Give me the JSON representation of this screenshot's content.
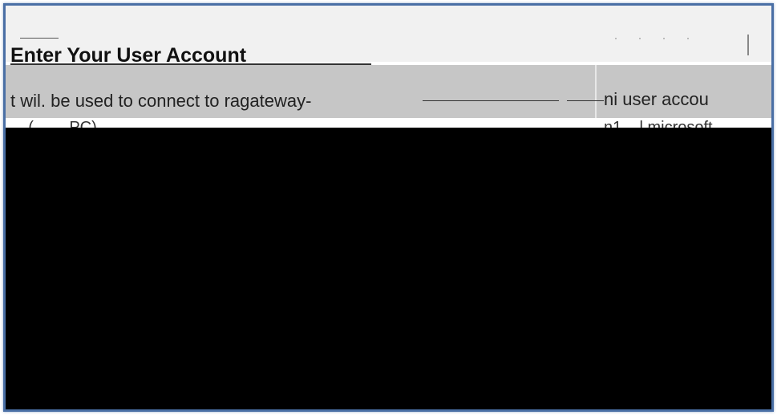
{
  "dialog": {
    "title": "Enter Your User Account",
    "line_left": "t wil. be used to connect to ragateway-",
    "line_right": "ni  user accou",
    "partial_left": "... (... ... PC) ... ... ... ...",
    "partial_right": "n1 ...l microsoft"
  },
  "colors": {
    "frame_border": "#4a6fa5",
    "top_background": "#f1f1f1",
    "panel_grey": "#c6c6c6",
    "content_black": "#000000"
  }
}
